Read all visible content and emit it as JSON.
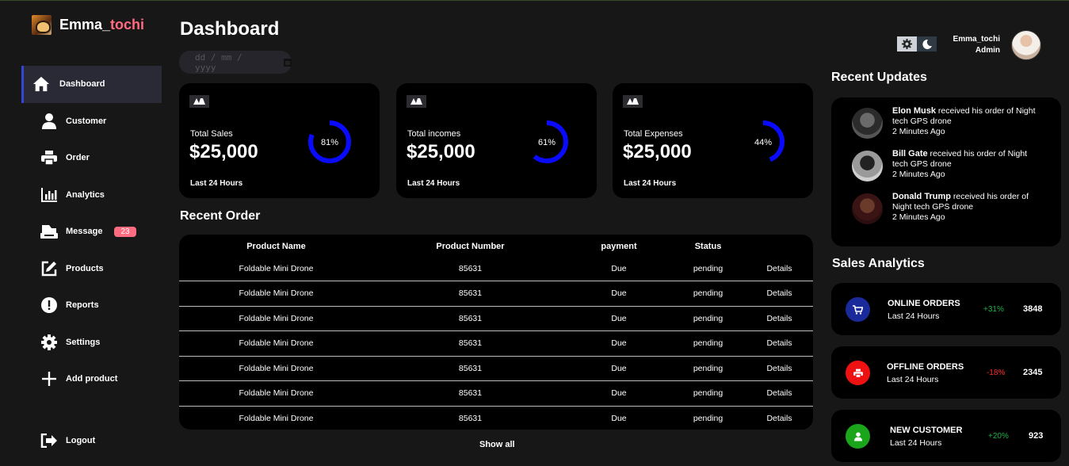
{
  "brand": {
    "name_prefix": "Emma_",
    "name_accent": "tochi"
  },
  "sidebar": {
    "items": [
      {
        "label": "Dashboard",
        "icon": "home-icon"
      },
      {
        "label": "Customer",
        "icon": "person-icon"
      },
      {
        "label": "Order",
        "icon": "printer-icon"
      },
      {
        "label": "Analytics",
        "icon": "bar-chart-icon"
      },
      {
        "label": "Message",
        "icon": "inbox-icon",
        "badge": "23"
      },
      {
        "label": "Products",
        "icon": "edit-icon"
      },
      {
        "label": "Reports",
        "icon": "alert-icon"
      },
      {
        "label": "Settings",
        "icon": "gear-icon"
      },
      {
        "label": "Add product",
        "icon": "plus-icon"
      }
    ],
    "logout_label": "Logout"
  },
  "header": {
    "title": "Dashboard",
    "date_placeholder": "dd / mm / yyyy"
  },
  "cards": [
    {
      "label": "Total Sales",
      "amount": "$25,000",
      "percent_text": "81%",
      "percent": 81,
      "footer": "Last 24 Hours"
    },
    {
      "label": "Total incomes",
      "amount": "$25,000",
      "percent_text": "61%",
      "percent": 61,
      "footer": "Last 24 Hours"
    },
    {
      "label": "Total Expenses",
      "amount": "$25,000",
      "percent_text": "44%",
      "percent": 44,
      "footer": "Last 24 Hours"
    }
  ],
  "recent_order": {
    "title": "Recent Order",
    "columns": [
      "Product Name",
      "Product Number",
      "payment",
      "Status",
      ""
    ],
    "rows": [
      {
        "name": "Foldable Mini Drone",
        "number": "85631",
        "payment": "Due",
        "status": "pending",
        "action": "Details"
      },
      {
        "name": "Foldable Mini Drone",
        "number": "85631",
        "payment": "Due",
        "status": "pending",
        "action": "Details"
      },
      {
        "name": "Foldable Mini Drone",
        "number": "85631",
        "payment": "Due",
        "status": "pending",
        "action": "Details"
      },
      {
        "name": "Foldable Mini Drone",
        "number": "85631",
        "payment": "Due",
        "status": "pending",
        "action": "Details"
      },
      {
        "name": "Foldable Mini Drone",
        "number": "85631",
        "payment": "Due",
        "status": "pending",
        "action": "Details"
      },
      {
        "name": "Foldable Mini Drone",
        "number": "85631",
        "payment": "Due",
        "status": "pending",
        "action": "Details"
      },
      {
        "name": "Foldable Mini Drone",
        "number": "85631",
        "payment": "Due",
        "status": "pending",
        "action": "Details"
      }
    ],
    "show_all": "Show all"
  },
  "user": {
    "name": "Emma_tochi",
    "role": "Admin"
  },
  "updates": {
    "title": "Recent Updates",
    "items": [
      {
        "name": "Elon Musk",
        "text": " received his order of Night tech GPS drone",
        "time": "2 Minutes Ago"
      },
      {
        "name": "Bill Gate",
        "text": " received his order of Night tech GPS drone",
        "time": "2 Minutes Ago"
      },
      {
        "name": "Donald Trump",
        "text": " received his order of Night tech GPS drone",
        "time": "2 Minutes Ago"
      }
    ]
  },
  "analytics": {
    "title": "Sales Analytics",
    "items": [
      {
        "title": "ONLINE ORDERS",
        "sub": "Last 24 Hours",
        "change": "+31%",
        "value": "3848",
        "color": "#1a2a9a",
        "icon": "cart-icon",
        "change_color": "#22b04a"
      },
      {
        "title": "OFFLINE ORDERS",
        "sub": "Last 24 Hours",
        "change": "-18%",
        "value": "2345",
        "color": "#ee1111",
        "icon": "printer-icon",
        "change_color": "#ff2a2a"
      },
      {
        "title": "NEW CUSTOMER",
        "sub": "Last 24 Hours",
        "change": "+20%",
        "value": "923",
        "color": "#1aa51a",
        "icon": "person-icon",
        "change_color": "#22b04a"
      }
    ]
  },
  "colors": {
    "accent": "#3447d8",
    "brand_accent": "#ff6b7f",
    "ring": "#0a0aff",
    "card_bg": "#000000",
    "page_bg": "#181718"
  }
}
